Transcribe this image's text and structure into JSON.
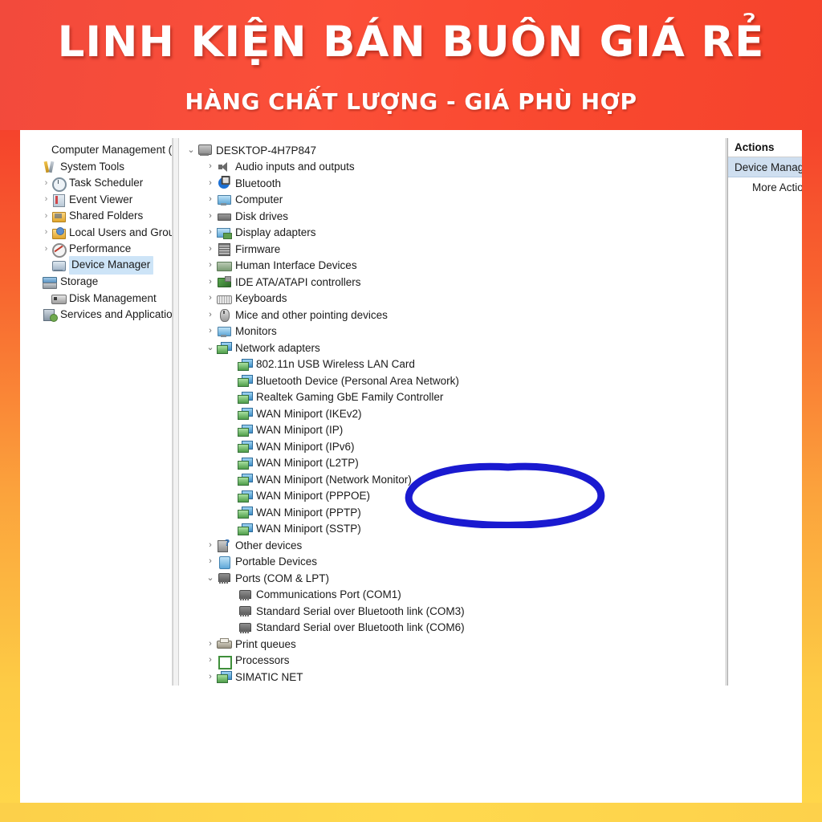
{
  "banner": {
    "line1": "LINH KIỆN BÁN BUÔN GIÁ RẺ",
    "line2": "HÀNG CHẤT LƯỢNG - GIÁ PHÙ HỢP",
    "bg_color": "#f9482f",
    "text_color": "#ffffff"
  },
  "frame": {
    "gradient_top_color": "#f5432c",
    "gradient_bottom_color": "#ffd84b"
  },
  "console_tree": {
    "items": [
      {
        "label": "Computer Management (Local)",
        "icon": "none",
        "twisty": "",
        "indent": 0,
        "selected": false
      },
      {
        "label": "System Tools",
        "icon": "tools-icon",
        "twisty": "",
        "indent": 1,
        "selected": false
      },
      {
        "label": "Task Scheduler",
        "icon": "clock-icon",
        "twisty": "›",
        "indent": 2,
        "selected": false
      },
      {
        "label": "Event Viewer",
        "icon": "event-log-icon",
        "twisty": "›",
        "indent": 2,
        "selected": false
      },
      {
        "label": "Shared Folders",
        "icon": "shared-folder-icon",
        "twisty": "›",
        "indent": 2,
        "selected": false
      },
      {
        "label": "Local Users and Groups",
        "icon": "users-group-icon",
        "twisty": "›",
        "indent": 2,
        "selected": false
      },
      {
        "label": "Performance",
        "icon": "performance-gauge-icon",
        "twisty": "›",
        "indent": 2,
        "selected": false
      },
      {
        "label": "Device Manager",
        "icon": "device-manager-icon",
        "twisty": "",
        "indent": 2,
        "selected": true
      },
      {
        "label": "Storage",
        "icon": "storage-icon",
        "twisty": "",
        "indent": 1,
        "selected": false
      },
      {
        "label": "Disk Management",
        "icon": "disk-management-icon",
        "twisty": "",
        "indent": 2,
        "selected": false
      },
      {
        "label": "Services and Applications",
        "icon": "services-icon",
        "twisty": "",
        "indent": 1,
        "selected": false
      }
    ]
  },
  "device_tree": {
    "items": [
      {
        "label": "DESKTOP-4H7P847",
        "icon": "computer-icon",
        "twisty": "⌄",
        "level": 1
      },
      {
        "label": "Audio inputs and outputs",
        "icon": "speaker-icon",
        "twisty": "›",
        "level": 2
      },
      {
        "label": "Bluetooth",
        "icon": "bluetooth-icon",
        "twisty": "›",
        "level": 2
      },
      {
        "label": "Computer",
        "icon": "monitor-icon",
        "twisty": "›",
        "level": 2
      },
      {
        "label": "Disk drives",
        "icon": "disk-drive-icon",
        "twisty": "›",
        "level": 2
      },
      {
        "label": "Display adapters",
        "icon": "display-adapter-icon",
        "twisty": "›",
        "level": 2
      },
      {
        "label": "Firmware",
        "icon": "firmware-chip-icon",
        "twisty": "›",
        "level": 2
      },
      {
        "label": "Human Interface Devices",
        "icon": "hid-icon",
        "twisty": "›",
        "level": 2
      },
      {
        "label": "IDE ATA/ATAPI controllers",
        "icon": "ide-controller-icon",
        "twisty": "›",
        "level": 2
      },
      {
        "label": "Keyboards",
        "icon": "keyboard-icon",
        "twisty": "›",
        "level": 2
      },
      {
        "label": "Mice and other pointing devices",
        "icon": "mouse-icon",
        "twisty": "›",
        "level": 2
      },
      {
        "label": "Monitors",
        "icon": "monitor-icon",
        "twisty": "›",
        "level": 2
      },
      {
        "label": "Network adapters",
        "icon": "network-adapter-icon",
        "twisty": "⌄",
        "level": 2
      },
      {
        "label": "802.11n USB Wireless LAN Card",
        "icon": "network-adapter-icon",
        "twisty": "",
        "level": 3
      },
      {
        "label": "Bluetooth Device (Personal Area Network)",
        "icon": "network-adapter-icon",
        "twisty": "",
        "level": 3
      },
      {
        "label": "Realtek Gaming GbE Family Controller",
        "icon": "network-adapter-icon",
        "twisty": "",
        "level": 3
      },
      {
        "label": "WAN Miniport (IKEv2)",
        "icon": "network-adapter-icon",
        "twisty": "",
        "level": 3
      },
      {
        "label": "WAN Miniport (IP)",
        "icon": "network-adapter-icon",
        "twisty": "",
        "level": 3
      },
      {
        "label": "WAN Miniport (IPv6)",
        "icon": "network-adapter-icon",
        "twisty": "",
        "level": 3
      },
      {
        "label": "WAN Miniport (L2TP)",
        "icon": "network-adapter-icon",
        "twisty": "",
        "level": 3
      },
      {
        "label": "WAN Miniport (Network Monitor)",
        "icon": "network-adapter-icon",
        "twisty": "",
        "level": 3
      },
      {
        "label": "WAN Miniport (PPPOE)",
        "icon": "network-adapter-icon",
        "twisty": "",
        "level": 3
      },
      {
        "label": "WAN Miniport (PPTP)",
        "icon": "network-adapter-icon",
        "twisty": "",
        "level": 3
      },
      {
        "label": "WAN Miniport (SSTP)",
        "icon": "network-adapter-icon",
        "twisty": "",
        "level": 3
      },
      {
        "label": "Other devices",
        "icon": "unknown-device-icon",
        "twisty": "›",
        "level": 2
      },
      {
        "label": "Portable Devices",
        "icon": "portable-device-icon",
        "twisty": "›",
        "level": 2
      },
      {
        "label": "Ports (COM & LPT)",
        "icon": "port-icon",
        "twisty": "⌄",
        "level": 2
      },
      {
        "label": "Communications Port (COM1)",
        "icon": "port-icon",
        "twisty": "",
        "level": 3
      },
      {
        "label": "Standard Serial over Bluetooth link (COM3)",
        "icon": "port-icon",
        "twisty": "",
        "level": 3
      },
      {
        "label": "Standard Serial over Bluetooth link (COM6)",
        "icon": "port-icon",
        "twisty": "",
        "level": 3
      },
      {
        "label": "Print queues",
        "icon": "printer-icon",
        "twisty": "›",
        "level": 2
      },
      {
        "label": "Processors",
        "icon": "processor-icon",
        "twisty": "›",
        "level": 2
      },
      {
        "label": "SIMATIC NET",
        "icon": "network-adapter-icon",
        "twisty": "›",
        "level": 2
      }
    ]
  },
  "actions_pane": {
    "header": "Actions",
    "selected_item": "Device Manage",
    "more_item": "More Actio"
  },
  "scrollbar": {
    "up_arrow": "⌃",
    "down_arrow": "⌄"
  },
  "annotation": {
    "shape": "hand-drawn-ellipse",
    "color": "#1a1ad0",
    "target_label": "802.11n USB Wireless LAN Card"
  }
}
